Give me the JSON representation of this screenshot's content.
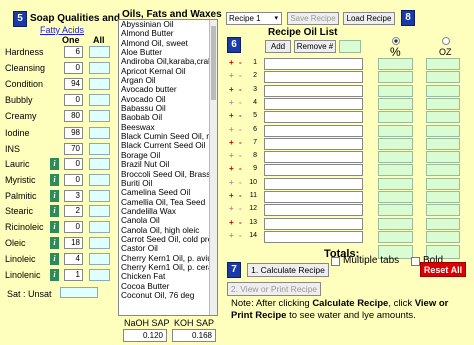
{
  "steps": {
    "s5": "5",
    "s6": "6",
    "s7": "7",
    "s8": "8"
  },
  "soap": {
    "title": "Soap Qualities and",
    "link": "Fatty Acids",
    "col_one": "One",
    "col_all": "All",
    "qualities": [
      {
        "label": "Hardness",
        "one": "6"
      },
      {
        "label": "Cleansing",
        "one": "0"
      },
      {
        "label": "Condition",
        "one": "94"
      },
      {
        "label": "Bubbly",
        "one": "0"
      },
      {
        "label": "Creamy",
        "one": "80"
      },
      {
        "label": "Iodine",
        "one": "98"
      },
      {
        "label": "INS",
        "one": "70"
      }
    ],
    "fatty_acids": [
      {
        "label": "Lauric",
        "one": "0"
      },
      {
        "label": "Myristic",
        "one": "0"
      },
      {
        "label": "Palmitic",
        "one": "3"
      },
      {
        "label": "Stearic",
        "one": "2"
      },
      {
        "label": "Ricinoleic",
        "one": "0"
      },
      {
        "label": "Oleic",
        "one": "18"
      },
      {
        "label": "Linoleic",
        "one": "4"
      },
      {
        "label": "Linolenic",
        "one": "1"
      }
    ],
    "info_glyph": "i",
    "sat_unsat_label": "Sat : Unsat"
  },
  "oils": {
    "title": "Oils, Fats and Waxes",
    "items": [
      "Abyssinian Oil",
      "Almond Butter",
      "Almond Oil, sweet",
      "Aloe Butter",
      "Andiroba Oil,karaba,crab",
      "Apricot Kernal Oil",
      "Argan Oil",
      "Avocado butter",
      "Avocado Oil",
      "Babassu Oil",
      "Baobab Oil",
      "Beeswax",
      "Black Cumin Seed Oil, ni",
      "Black Current Seed Oil",
      "Borage Oil",
      "Brazil Nut Oil",
      "Broccoli Seed Oil, Brassi",
      "Buriti Oil",
      "Camelina Seed Oil",
      "Camellia Oil, Tea Seed",
      "Candelilla Wax",
      "Canola Oil",
      "Canola Oil, high oleic",
      "Carrot Seed Oil, cold pre",
      "Castor Oil",
      "Cherry Kern1 Oil, p. aviur",
      "Cherry Kern1 Oil, p. cera",
      "Chicken Fat",
      "Cocoa Butter",
      "Coconut Oil, 76 deg"
    ],
    "naoh_label": "NaOH SAP",
    "koh_label": "KOH SAP",
    "naoh_value": "0.120",
    "koh_value": "0.168"
  },
  "recipe": {
    "select_value": "Recipe 1",
    "save_label": "Save Recipe",
    "load_label": "Load Recipe",
    "list_title": "Recipe Oil List",
    "add_label": "Add",
    "remove_label": "Remove #",
    "percent_label": "%",
    "oz_label": "OZ",
    "row_plus": "+",
    "row_minus": "-",
    "rows": [
      "1",
      "2",
      "3",
      "4",
      "5",
      "6",
      "7",
      "8",
      "9",
      "10",
      "11",
      "12",
      "13",
      "14"
    ],
    "totals_label": "Totals:",
    "calc_label": "1. Calculate Recipe",
    "view_label": "2. View or Print Recipe",
    "reset_label": "Reset All",
    "multiple_tabs_label": "Multiple tabs",
    "bold_label": "Bold",
    "note_prefix": "Note: After clicking ",
    "note_calc": "Calculate Recipe",
    "note_mid": ", click ",
    "note_view": "View or Print Recipe",
    "note_suffix": " to see water and lye amounts."
  },
  "colors": {
    "background": "#ffffbd",
    "step_box": "#1a3aa8",
    "info_icon": "#2e8b57",
    "reset": "#dd0000",
    "accent_green": "#d9fcd2",
    "accent_cyan": "#e0ffff"
  }
}
